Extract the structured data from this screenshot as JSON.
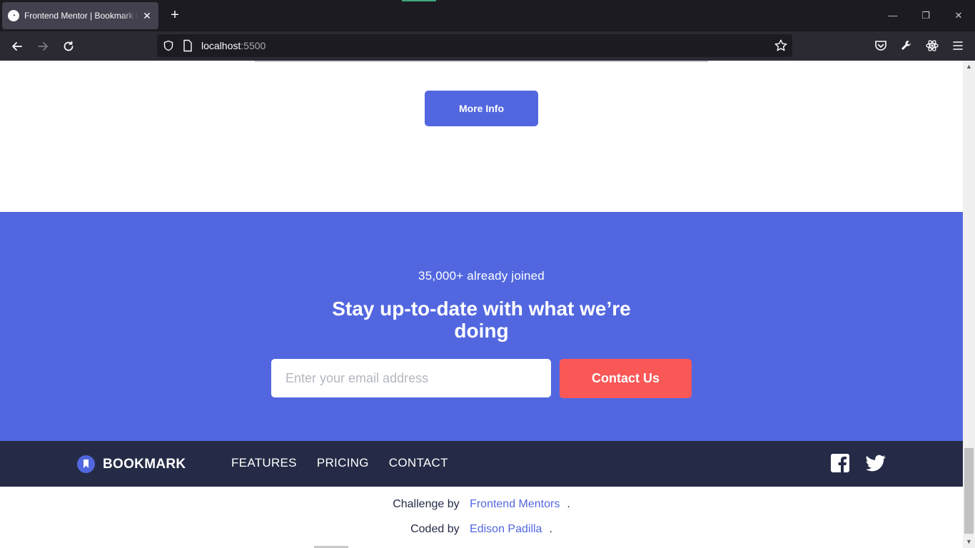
{
  "browser": {
    "tab_title": "Frontend Mentor | Bookmark landing page",
    "new_tab_label": "+",
    "url_host": "localhost",
    "url_port": ":5500",
    "window_controls": [
      "minimize-icon",
      "restore-icon",
      "close-icon"
    ],
    "toolbar_icons": [
      "pocket-icon",
      "devtools-wrench-icon",
      "react-devtools-icon",
      "menu-icon"
    ]
  },
  "page": {
    "more_info_label": "More Info",
    "cta": {
      "kicker": "35,000+ already joined",
      "heading": "Stay up-to-date with what we’re doing",
      "email_placeholder": "Enter your email address",
      "submit_label": "Contact Us"
    },
    "footer": {
      "logo_text": "BOOKMARK",
      "nav": [
        "FEATURES",
        "PRICING",
        "CONTACT"
      ],
      "social_icons": [
        "facebook-icon",
        "twitter-icon"
      ]
    },
    "attribution": {
      "challenge_prefix": "Challenge by",
      "challenge_link": "Frontend Mentors",
      "coded_prefix": "Coded by",
      "coded_link": "Edison Padilla",
      "period": "."
    }
  },
  "colors": {
    "primary_blue": "#5267df",
    "soft_red": "#fa5757",
    "dark_navy": "#252b46"
  }
}
